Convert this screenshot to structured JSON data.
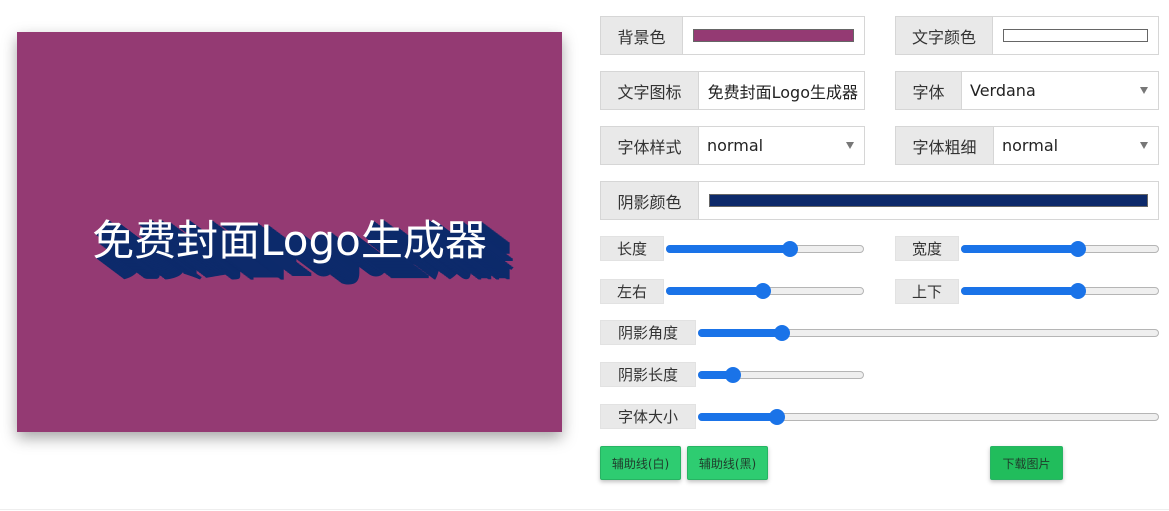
{
  "preview": {
    "logo_text": "免费封面Logo生成器",
    "background_color": "#943a73",
    "text_color": "#ffffff",
    "shadow_color": "#0d2a6b"
  },
  "fields": {
    "bg_color": {
      "label": "背景色",
      "value": "#943a73"
    },
    "text_color": {
      "label": "文字颜色",
      "value": "#ffffff"
    },
    "text_icon": {
      "label": "文字图标",
      "value": "免费封面Logo生成器"
    },
    "font": {
      "label": "字体",
      "value": "Verdana"
    },
    "font_style": {
      "label": "字体样式",
      "value": "normal"
    },
    "font_weight": {
      "label": "字体粗细",
      "value": "normal"
    },
    "shadow_color": {
      "label": "阴影颜色",
      "value": "#0d2a6b"
    }
  },
  "sliders": {
    "length": {
      "label": "长度",
      "value": 0.63
    },
    "width": {
      "label": "宽度",
      "value": 0.59
    },
    "left_right": {
      "label": "左右",
      "value": 0.49
    },
    "up_down": {
      "label": "上下",
      "value": 0.59
    },
    "shadow_angle": {
      "label": "阴影角度",
      "value": 0.18
    },
    "shadow_length": {
      "label": "阴影长度",
      "value": 0.21
    },
    "font_size": {
      "label": "字体大小",
      "value": 0.17
    }
  },
  "buttons": {
    "guide_white": "辅助线(白)",
    "guide_black": "辅助线(黑)",
    "download": "下载图片"
  }
}
